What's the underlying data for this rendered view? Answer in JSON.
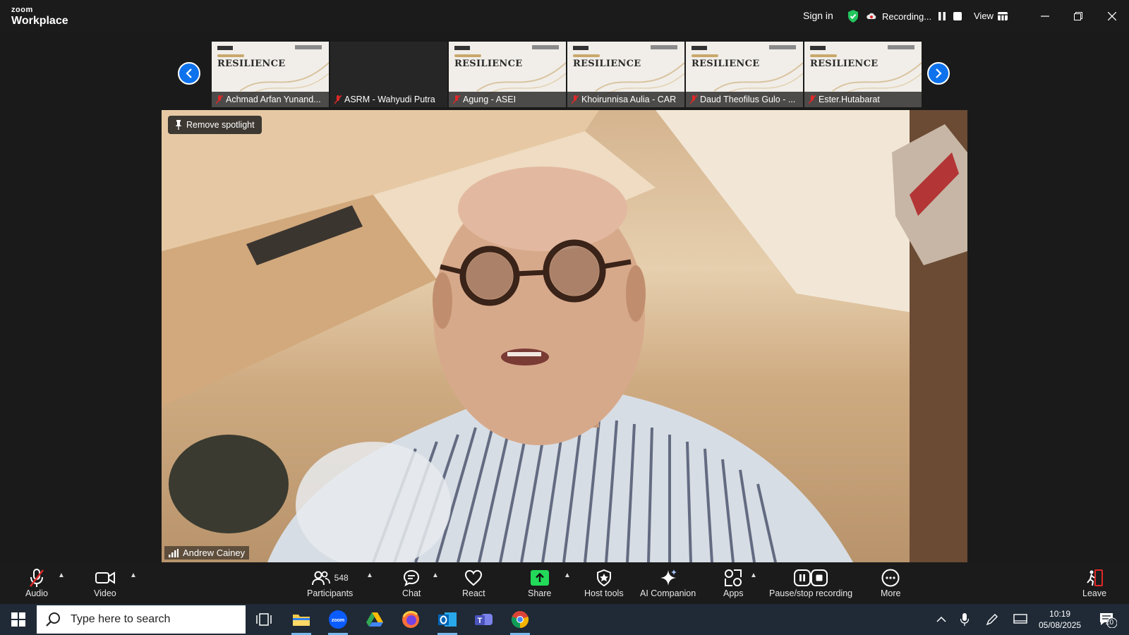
{
  "app": {
    "brand_top": "zoom",
    "brand_bottom": "Workplace"
  },
  "titlebar": {
    "sign_in": "Sign in",
    "recording": "Recording...",
    "view": "View"
  },
  "thumbnails": [
    {
      "name": "Achmad Arfan Yunand...",
      "slide": "RESILIENCE",
      "dark": false
    },
    {
      "name": "ASRM - Wahyudi Putra",
      "slide": "",
      "dark": true
    },
    {
      "name": "Agung - ASEI",
      "slide": "RESILIENCE",
      "dark": false
    },
    {
      "name": "Khoirunnisa Aulia - CAR",
      "slide": "RESILIENCE",
      "dark": false
    },
    {
      "name": "Daud Theofilus Gulo - ...",
      "slide": "RESILIENCE",
      "dark": false
    },
    {
      "name": "Ester.Hutabarat",
      "slide": "RESILIENCE",
      "dark": false
    }
  ],
  "video": {
    "remove_spotlight": "Remove spotlight",
    "speaker": "Andrew Cainey"
  },
  "toolbar": {
    "audio": "Audio",
    "video": "Video",
    "participants": "Participants",
    "participants_count": "548",
    "chat": "Chat",
    "react": "React",
    "share": "Share",
    "host_tools": "Host tools",
    "ai_companion": "AI Companion",
    "apps": "Apps",
    "pause_stop": "Pause/stop recording",
    "more": "More",
    "leave": "Leave"
  },
  "taskbar": {
    "search_placeholder": "Type here to search",
    "time": "10:19",
    "date": "05/08/2025",
    "notifications": "20"
  },
  "colors": {
    "accent": "#0e72ed",
    "recording_red": "#e02828",
    "share_green": "#23d959"
  }
}
